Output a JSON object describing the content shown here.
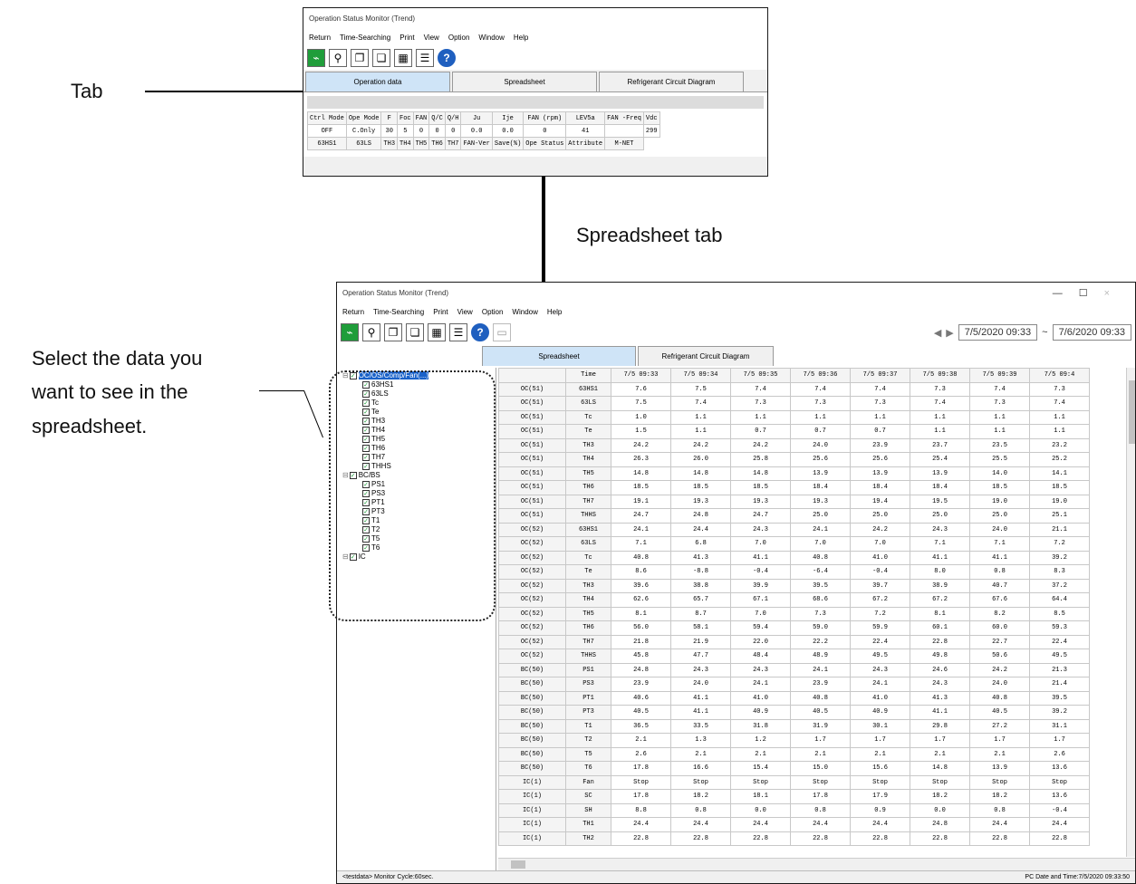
{
  "callouts": {
    "tab": "Tab",
    "spreadsheet_tab": "Spreadsheet tab",
    "select_line1": "Select the data you",
    "select_line2": "want to see in the",
    "select_line3": "spreadsheet."
  },
  "small_window": {
    "title": "Operation Status Monitor (Trend)",
    "menu": [
      "Return",
      "Time-Searching",
      "Print",
      "View",
      "Option",
      "Window",
      "Help"
    ],
    "tabs": [
      "Operation data",
      "Spreadsheet",
      "Refrigerant Circuit Diagram"
    ],
    "header_row": [
      "Ctrl Mode",
      "Ope Mode",
      "F",
      "Foc",
      "FAN",
      "Q/C",
      "Q/H",
      "Ju",
      "Ije",
      "FAN (rpm)",
      "LEV5a",
      "FAN -Freq",
      "Vdc"
    ],
    "value_row": [
      "OFF",
      "C.Only",
      "30",
      "5",
      "0",
      "0",
      "0",
      "0.0",
      "0.0",
      "0",
      "41",
      "",
      "299"
    ],
    "second_header": [
      "63HS1",
      "63LS",
      "TH3",
      "TH4",
      "TH5",
      "TH6",
      "TH7",
      "FAN-Ver",
      "Save(%)",
      "Ope Status",
      "Attribute",
      "M-NET"
    ]
  },
  "big_window": {
    "title": "Operation Status Monitor (Trend)",
    "menu": [
      "Return",
      "Time-Searching",
      "Print",
      "View",
      "Option",
      "Window",
      "Help"
    ],
    "date_from": "7/5/2020 09:33",
    "date_sep": "~",
    "date_to": "7/6/2020 09:33",
    "tabs": [
      "Spreadsheet",
      "Refrigerant Circuit Diagram"
    ],
    "status_left": "<testdata> Monitor Cycle:60sec.",
    "status_right": "PC Date and Time:7/5/2020 09:33:50",
    "tree": [
      {
        "label": "OC/OS/Comp/Fan(...)",
        "level": 0,
        "selected": true
      },
      {
        "label": "63HS1",
        "level": 1
      },
      {
        "label": "63LS",
        "level": 1
      },
      {
        "label": "Tc",
        "level": 1
      },
      {
        "label": "Te",
        "level": 1
      },
      {
        "label": "TH3",
        "level": 1
      },
      {
        "label": "TH4",
        "level": 1
      },
      {
        "label": "TH5",
        "level": 1
      },
      {
        "label": "TH6",
        "level": 1
      },
      {
        "label": "TH7",
        "level": 1
      },
      {
        "label": "THHS",
        "level": 1
      },
      {
        "label": "BC/BS",
        "level": 0
      },
      {
        "label": "PS1",
        "level": 1
      },
      {
        "label": "PS3",
        "level": 1
      },
      {
        "label": "PT1",
        "level": 1
      },
      {
        "label": "PT3",
        "level": 1
      },
      {
        "label": "T1",
        "level": 1
      },
      {
        "label": "T2",
        "level": 1
      },
      {
        "label": "T5",
        "level": 1
      },
      {
        "label": "T6",
        "level": 1
      },
      {
        "label": "IC",
        "level": 0
      }
    ],
    "columns": [
      "Time",
      "7/5 09:33",
      "7/5 09:34",
      "7/5 09:35",
      "7/5 09:36",
      "7/5 09:37",
      "7/5 09:38",
      "7/5 09:39",
      "7/5 09:4"
    ],
    "rows": [
      [
        "OC(51)",
        "63HS1",
        "7.6",
        "7.5",
        "7.4",
        "7.4",
        "7.4",
        "7.3",
        "7.4",
        "7.3"
      ],
      [
        "OC(51)",
        "63LS",
        "7.5",
        "7.4",
        "7.3",
        "7.3",
        "7.3",
        "7.4",
        "7.3",
        "7.4"
      ],
      [
        "OC(51)",
        "Tc",
        "1.0",
        "1.1",
        "1.1",
        "1.1",
        "1.1",
        "1.1",
        "1.1",
        "1.1"
      ],
      [
        "OC(51)",
        "Te",
        "1.5",
        "1.1",
        "0.7",
        "0.7",
        "0.7",
        "1.1",
        "1.1",
        "1.1"
      ],
      [
        "OC(51)",
        "TH3",
        "24.2",
        "24.2",
        "24.2",
        "24.0",
        "23.9",
        "23.7",
        "23.5",
        "23.2"
      ],
      [
        "OC(51)",
        "TH4",
        "26.3",
        "26.0",
        "25.8",
        "25.6",
        "25.6",
        "25.4",
        "25.5",
        "25.2"
      ],
      [
        "OC(51)",
        "TH5",
        "14.8",
        "14.8",
        "14.8",
        "13.9",
        "13.9",
        "13.9",
        "14.0",
        "14.1"
      ],
      [
        "OC(51)",
        "TH6",
        "18.5",
        "18.5",
        "18.5",
        "18.4",
        "18.4",
        "18.4",
        "18.5",
        "18.5"
      ],
      [
        "OC(51)",
        "TH7",
        "19.1",
        "19.3",
        "19.3",
        "19.3",
        "19.4",
        "19.5",
        "19.0",
        "19.0"
      ],
      [
        "OC(51)",
        "THHS",
        "24.7",
        "24.8",
        "24.7",
        "25.0",
        "25.0",
        "25.0",
        "25.0",
        "25.1"
      ],
      [
        "OC(52)",
        "63HS1",
        "24.1",
        "24.4",
        "24.3",
        "24.1",
        "24.2",
        "24.3",
        "24.0",
        "21.1"
      ],
      [
        "OC(52)",
        "63LS",
        "7.1",
        "6.8",
        "7.0",
        "7.0",
        "7.0",
        "7.1",
        "7.1",
        "7.2"
      ],
      [
        "OC(52)",
        "Tc",
        "40.8",
        "41.3",
        "41.1",
        "40.8",
        "41.0",
        "41.1",
        "41.1",
        "39.2"
      ],
      [
        "OC(52)",
        "Te",
        "8.6",
        "-8.8",
        "-0.4",
        "-6.4",
        "-0.4",
        "8.0",
        "0.8",
        "8.3"
      ],
      [
        "OC(52)",
        "TH3",
        "39.6",
        "38.8",
        "39.9",
        "39.5",
        "39.7",
        "38.9",
        "40.7",
        "37.2"
      ],
      [
        "OC(52)",
        "TH4",
        "62.6",
        "65.7",
        "67.1",
        "68.6",
        "67.2",
        "67.2",
        "67.6",
        "64.4"
      ],
      [
        "OC(52)",
        "TH5",
        "8.1",
        "8.7",
        "7.0",
        "7.3",
        "7.2",
        "8.1",
        "8.2",
        "8.5"
      ],
      [
        "OC(52)",
        "TH6",
        "56.0",
        "58.1",
        "59.4",
        "59.0",
        "59.9",
        "60.1",
        "60.0",
        "59.3"
      ],
      [
        "OC(52)",
        "TH7",
        "21.8",
        "21.9",
        "22.0",
        "22.2",
        "22.4",
        "22.8",
        "22.7",
        "22.4"
      ],
      [
        "OC(52)",
        "THHS",
        "45.8",
        "47.7",
        "48.4",
        "48.9",
        "49.5",
        "49.8",
        "50.6",
        "49.5"
      ],
      [
        "BC(50)",
        "PS1",
        "24.8",
        "24.3",
        "24.3",
        "24.1",
        "24.3",
        "24.6",
        "24.2",
        "21.3"
      ],
      [
        "BC(50)",
        "PS3",
        "23.9",
        "24.0",
        "24.1",
        "23.9",
        "24.1",
        "24.3",
        "24.0",
        "21.4"
      ],
      [
        "BC(50)",
        "PT1",
        "40.6",
        "41.1",
        "41.0",
        "40.8",
        "41.0",
        "41.3",
        "40.8",
        "39.5"
      ],
      [
        "BC(50)",
        "PT3",
        "40.5",
        "41.1",
        "40.9",
        "40.5",
        "40.9",
        "41.1",
        "40.5",
        "39.2"
      ],
      [
        "BC(50)",
        "T1",
        "36.5",
        "33.5",
        "31.8",
        "31.9",
        "30.1",
        "29.8",
        "27.2",
        "31.1"
      ],
      [
        "BC(50)",
        "T2",
        "2.1",
        "1.3",
        "1.2",
        "1.7",
        "1.7",
        "1.7",
        "1.7",
        "1.7"
      ],
      [
        "BC(50)",
        "T5",
        "2.6",
        "2.1",
        "2.1",
        "2.1",
        "2.1",
        "2.1",
        "2.1",
        "2.6"
      ],
      [
        "BC(50)",
        "T6",
        "17.8",
        "16.6",
        "15.4",
        "15.0",
        "15.6",
        "14.8",
        "13.9",
        "13.6"
      ],
      [
        "IC(1)",
        "Fan",
        "Stop",
        "Stop",
        "Stop",
        "Stop",
        "Stop",
        "Stop",
        "Stop",
        "Stop"
      ],
      [
        "IC(1)",
        "SC",
        "17.8",
        "18.2",
        "18.1",
        "17.8",
        "17.9",
        "18.2",
        "18.2",
        "13.6"
      ],
      [
        "IC(1)",
        "SH",
        "8.8",
        "0.8",
        "0.0",
        "0.8",
        "0.9",
        "0.0",
        "0.8",
        "-0.4"
      ],
      [
        "IC(1)",
        "TH1",
        "24.4",
        "24.4",
        "24.4",
        "24.4",
        "24.4",
        "24.8",
        "24.4",
        "24.4"
      ],
      [
        "IC(1)",
        "TH2",
        "22.8",
        "22.8",
        "22.8",
        "22.8",
        "22.8",
        "22.8",
        "22.8",
        "22.8"
      ]
    ]
  }
}
